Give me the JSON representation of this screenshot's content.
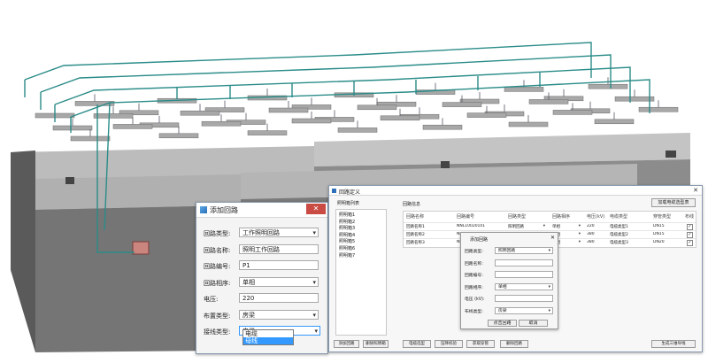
{
  "add_circuit_dialog": {
    "title": "添加回路",
    "fields": [
      {
        "label": "回路类型:",
        "value": "工作照明回路",
        "kind": "select"
      },
      {
        "label": "回路名称:",
        "value": "照明工作回路",
        "kind": "text"
      },
      {
        "label": "回路编号:",
        "value": "P1",
        "kind": "text"
      },
      {
        "label": "回路相序:",
        "value": "单相",
        "kind": "select"
      },
      {
        "label": "电压:",
        "value": "220",
        "kind": "text"
      },
      {
        "label": "布置类型:",
        "value": "房梁",
        "kind": "select"
      },
      {
        "label": "接线类型:",
        "value": "电缆",
        "kind": "select"
      }
    ],
    "dropdown_options": [
      "电缆",
      "母线"
    ]
  },
  "circuit_def_window": {
    "title": "回路定义",
    "list_header": "照明箱列表",
    "list_items": [
      "照明箱1",
      "照明箱2",
      "照明箱3",
      "照明箱4",
      "照明箱5",
      "照明箱6",
      "照明箱7"
    ],
    "info_header": "回路信息",
    "load_button": "加载电缆选型表",
    "columns": [
      "回路名称",
      "回路编号",
      "回路类型",
      "回路相序",
      "电压(kV)",
      "电缆类型",
      "穿管类型",
      "布线"
    ],
    "rows": [
      {
        "name": "回路名称1",
        "code": "NNL10020101",
        "type": "照明回路",
        "phase": "单相",
        "voltage": "220",
        "cable": "电缆类型1",
        "pipe": "DN15"
      },
      {
        "name": "回路名称2",
        "code": "NNL10020102",
        "type": "照明回路",
        "phase": "单相",
        "voltage": "380",
        "cable": "电缆类型2",
        "pipe": "DN15"
      },
      {
        "name": "回路名称3",
        "code": "NNL10020103",
        "type": "照明回路",
        "phase": "单相",
        "voltage": "380",
        "cable": "电缆类型3",
        "pipe": "DN20"
      }
    ],
    "bottom_buttons": [
      "添加回路",
      "删除照明箱",
      "电缆选型",
      "压降校验",
      "获取穿管",
      "删除回路",
      "生成三维导线"
    ]
  },
  "small_add_dialog": {
    "title": "添加回路",
    "fields": [
      {
        "label": "回路类型:",
        "value": "照明回路",
        "kind": "select"
      },
      {
        "label": "回路名称:",
        "value": "",
        "kind": "text"
      },
      {
        "label": "回路编号:",
        "value": "",
        "kind": "text"
      },
      {
        "label": "回路相序:",
        "value": "单相",
        "kind": "select"
      },
      {
        "label": "电压 (kV):",
        "value": "",
        "kind": "text"
      },
      {
        "label": "布线类型:",
        "value": "房梁",
        "kind": "select"
      }
    ],
    "buttons": [
      "点击回路",
      "取消"
    ]
  },
  "colors": {
    "pipe": "#2a8c88",
    "cabinet_front": "#7d7d7d",
    "cabinet_top": "#b9b9b9",
    "tray": "#a8a8a8",
    "accent": "#3399ff",
    "close": "#c94b43"
  }
}
